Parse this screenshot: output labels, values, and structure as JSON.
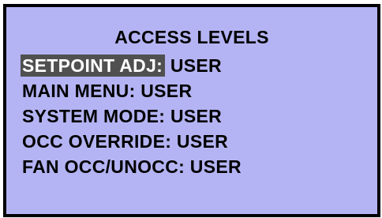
{
  "screen": {
    "title": "ACCESS LEVELS",
    "background_color": "#b4b4f4",
    "highlight_color": "#505050",
    "items": [
      {
        "label": "SETPOINT ADJ:",
        "value": "USER",
        "selected": true
      },
      {
        "label": "MAIN MENU:",
        "value": "USER",
        "selected": false
      },
      {
        "label": "SYSTEM MODE:",
        "value": "USER",
        "selected": false
      },
      {
        "label": "OCC OVERRIDE:",
        "value": "USER",
        "selected": false
      },
      {
        "label": "FAN OCC/UNOCC:",
        "value": "USER",
        "selected": false
      }
    ]
  }
}
